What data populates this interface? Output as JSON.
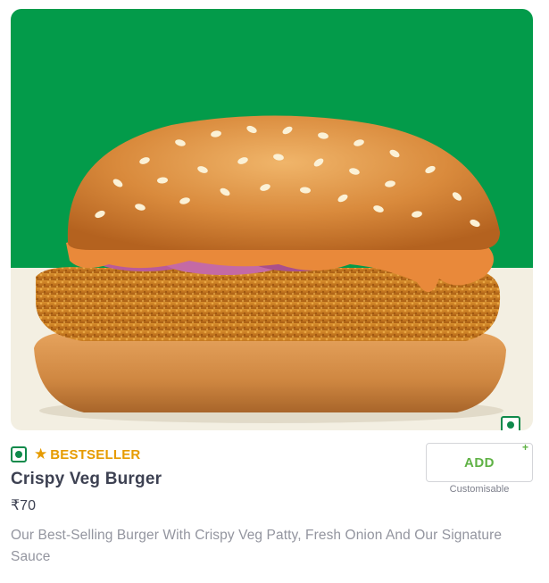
{
  "item": {
    "badge_label": "BESTSELLER",
    "name": "Crispy Veg Burger",
    "price": "₹70",
    "description": "Our Best-Selling Burger With Crispy Veg Patty, Fresh Onion And Our Signature Sauce",
    "image_alt_icon": "burger-image",
    "veg_icon": "veg-indicator-icon",
    "star_icon": "star-icon"
  },
  "add_button": {
    "label": "ADD",
    "plus": "+",
    "note": "Customisable"
  },
  "colors": {
    "image_bg_top": "#039b4a",
    "image_bg_bottom": "#f3efe2",
    "veg_green": "#0f8a4b",
    "bestseller_orange": "#e69b00",
    "add_green": "#60b246",
    "text_primary": "#3d4152",
    "text_secondary": "#93959f"
  }
}
